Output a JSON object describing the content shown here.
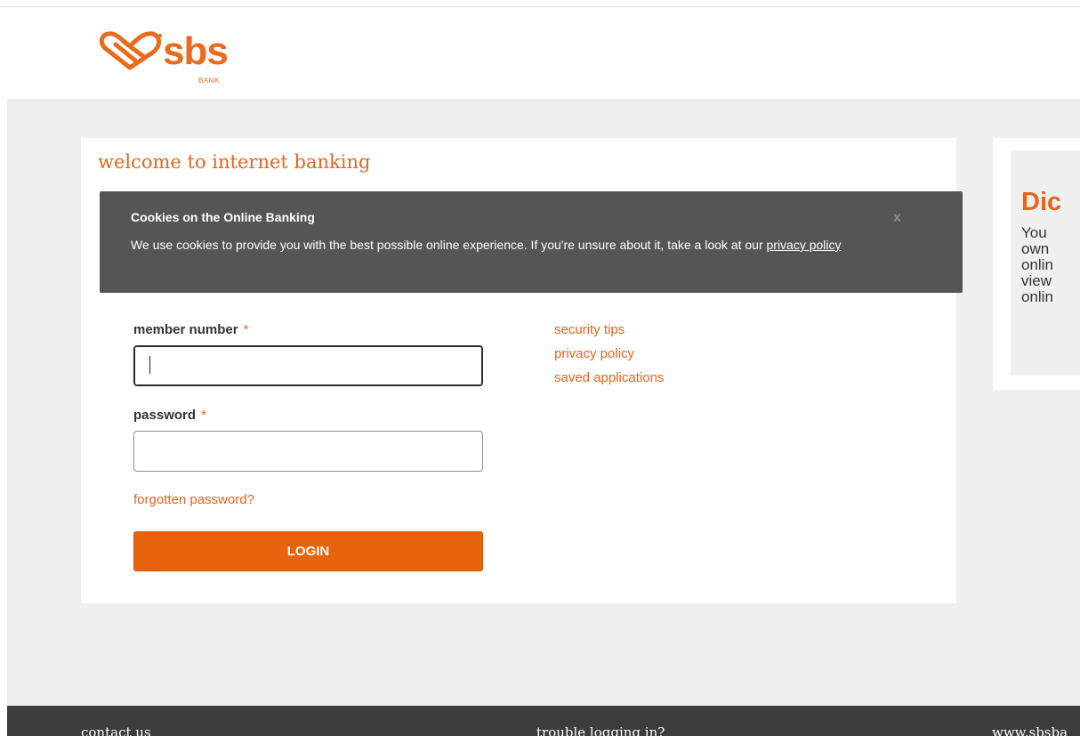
{
  "brand": {
    "name": "sbs",
    "sub": "BANK",
    "accent_color": "#e8641b",
    "button_color": "#e8640c",
    "footer_color": "#3c3c3c",
    "banner_color": "#555555"
  },
  "login": {
    "heading": "welcome to internet banking",
    "member_label": "member number",
    "password_label": "password",
    "required_marker": "*",
    "member_value": "",
    "password_value": "",
    "forgot_link": "forgotten password?",
    "login_button": "LOGIN"
  },
  "cookie_banner": {
    "title": "Cookies on the Online Banking",
    "text": "We use cookies to provide you with the best possible online experience. If you're unsure about it, take a look at our",
    "link": "privacy policy",
    "close": "x"
  },
  "side_links": [
    "security tips",
    "privacy policy",
    "saved applications"
  ],
  "promo": {
    "title": "Dic",
    "lines": [
      "You",
      "own",
      "onlin",
      "view",
      "onlin"
    ]
  },
  "footer": {
    "contact": "contact us",
    "trouble": "trouble logging in?",
    "website": "www.sbsba"
  },
  "icons": {
    "logo": "sbs-heart-logo-icon",
    "close": "close-icon"
  }
}
